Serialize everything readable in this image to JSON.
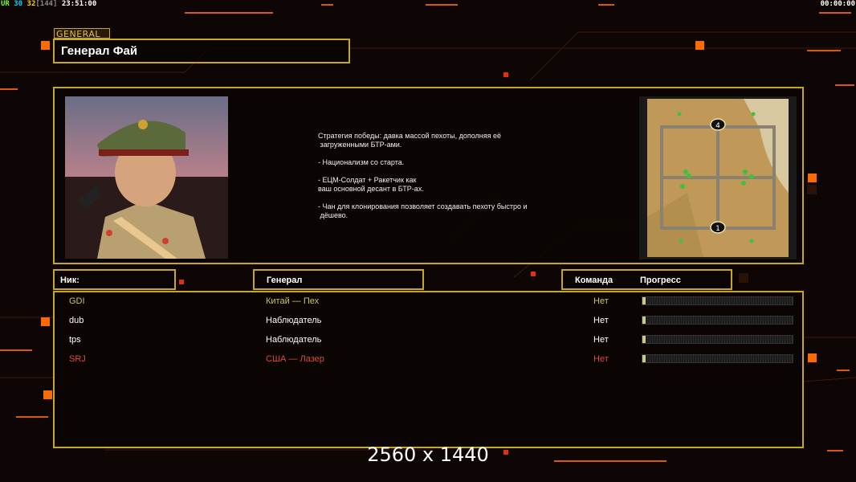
{
  "hud": {
    "left_ur": "UR",
    "left_val1": "30",
    "left_val2": "32",
    "left_bracket": "[144]",
    "left_clock": "23:51:00",
    "right_clock": "00:00:00"
  },
  "general_tag": "GENERAL",
  "title": "Генерал Фай",
  "description": [
    "Стратегия победы: давка массой пехоты, дополняя её",
    " загруженными БТР-ами.",
    "",
    "- Национализм со старта.",
    "",
    "- ЕЦМ-Солдат + Ракетчик как",
    "ваш основной десант в БТР-ах.",
    "",
    "- Чан для клонирования позволяет создавать пехоту быстро и",
    " дёшево."
  ],
  "map": {
    "markers": [
      "4",
      "1"
    ]
  },
  "headers": {
    "nick": "Ник:",
    "general": "Генерал",
    "team": "Команда",
    "progress": "Прогресс"
  },
  "players": [
    {
      "nick": "GDI",
      "general": "Китай — Пех",
      "team": "Нет",
      "progress": 0.02,
      "color": "#c8c860"
    },
    {
      "nick": "dub",
      "general": "Наблюдатель",
      "team": "Нет",
      "progress": 0.01,
      "color": "#ffffff"
    },
    {
      "nick": "tps",
      "general": "Наблюдатель",
      "team": "Нет",
      "progress": 0.01,
      "color": "#ffffff"
    },
    {
      "nick": "SRJ",
      "general": "США — Лазер",
      "team": "Нет",
      "progress": 0.01,
      "color": "#d8503a"
    }
  ],
  "resolution_label": "2560 x 1440",
  "colors": {
    "frame": "#c8a81e",
    "accent_orange": "#ff6a00",
    "hud_green": "#7cfc00",
    "hud_cyan": "#00d0ff",
    "hud_yellow": "#ffd000"
  }
}
